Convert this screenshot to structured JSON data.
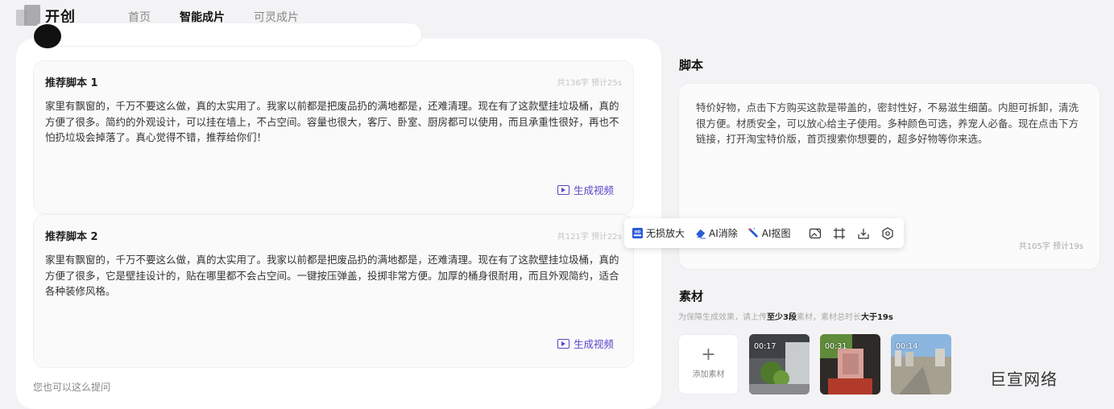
{
  "header": {
    "logo_text": "开创",
    "nav": [
      {
        "label": "首页",
        "active": false
      },
      {
        "label": "智能成片",
        "active": true
      },
      {
        "label": "可灵成片",
        "active": false
      }
    ]
  },
  "scripts": [
    {
      "title": "推荐脚本 1",
      "meta": "共136字 预计25s",
      "body": "家里有飘窗的，千万不要这么做，真的太实用了。我家以前都是把废品扔的满地都是，还难清理。现在有了这款壁挂垃圾桶，真的方便了很多。简约的外观设计，可以挂在墙上，不占空间。容量也很大，客厅、卧室、厨房都可以使用，而且承重性很好，再也不怕扔垃圾会掉落了。真心觉得不错，推荐给你们！",
      "action": "生成视频"
    },
    {
      "title": "推荐脚本 2",
      "meta": "共121字 预计22s",
      "body": "家里有飘窗的，千万不要这么做，真的太实用了。我家以前都是把废品扔的满地都是，还难清理。现在有了这款壁挂垃圾桶，真的方便了很多，它是壁挂设计的，贴在哪里都不会占空间。一键按压弹盖，投掷非常方便。加厚的桶身很耐用，而且外观简约，适合各种装修风格。",
      "action": "生成视频"
    }
  ],
  "hint": "您也可以这么提问",
  "script_panel": {
    "title": "脚本",
    "text": "特价好物，点击下方购买这款是带盖的，密封性好，不易滋生细菌。内胆可拆卸，清洗很方便。材质安全，可以放心给主子使用。多种颜色可选，养宠人必备。现在点击下方链接，打开淘宝特价版，首页搜索你想要的，超多好物等你来选。",
    "meta": "共105字 预计19s"
  },
  "toolbar": {
    "items": [
      {
        "label": "无损放大",
        "icon": "hd-upscale-icon"
      },
      {
        "label": "AI消除",
        "icon": "eraser-icon"
      },
      {
        "label": "AI抠图",
        "icon": "magic-wand-icon"
      }
    ],
    "icon_buttons": [
      "image-edit-icon",
      "crop-icon",
      "download-icon",
      "settings-icon"
    ]
  },
  "materials": {
    "title": "素材",
    "sub_pre": "为保障生成效果，请上传",
    "sub_b1": "至少3段",
    "sub_mid": "素材，素材总时长",
    "sub_b2": "大于19s",
    "add_plus": "+",
    "add_label": "添加素材",
    "thumbs": [
      {
        "duration": "00:17"
      },
      {
        "duration": "00:31"
      },
      {
        "duration": "00:14"
      }
    ]
  },
  "watermark": "巨宣网络",
  "colors": {
    "accent": "#5b45c8",
    "page_bg": "#f3f3f5",
    "card_bg": "#fafafb"
  }
}
